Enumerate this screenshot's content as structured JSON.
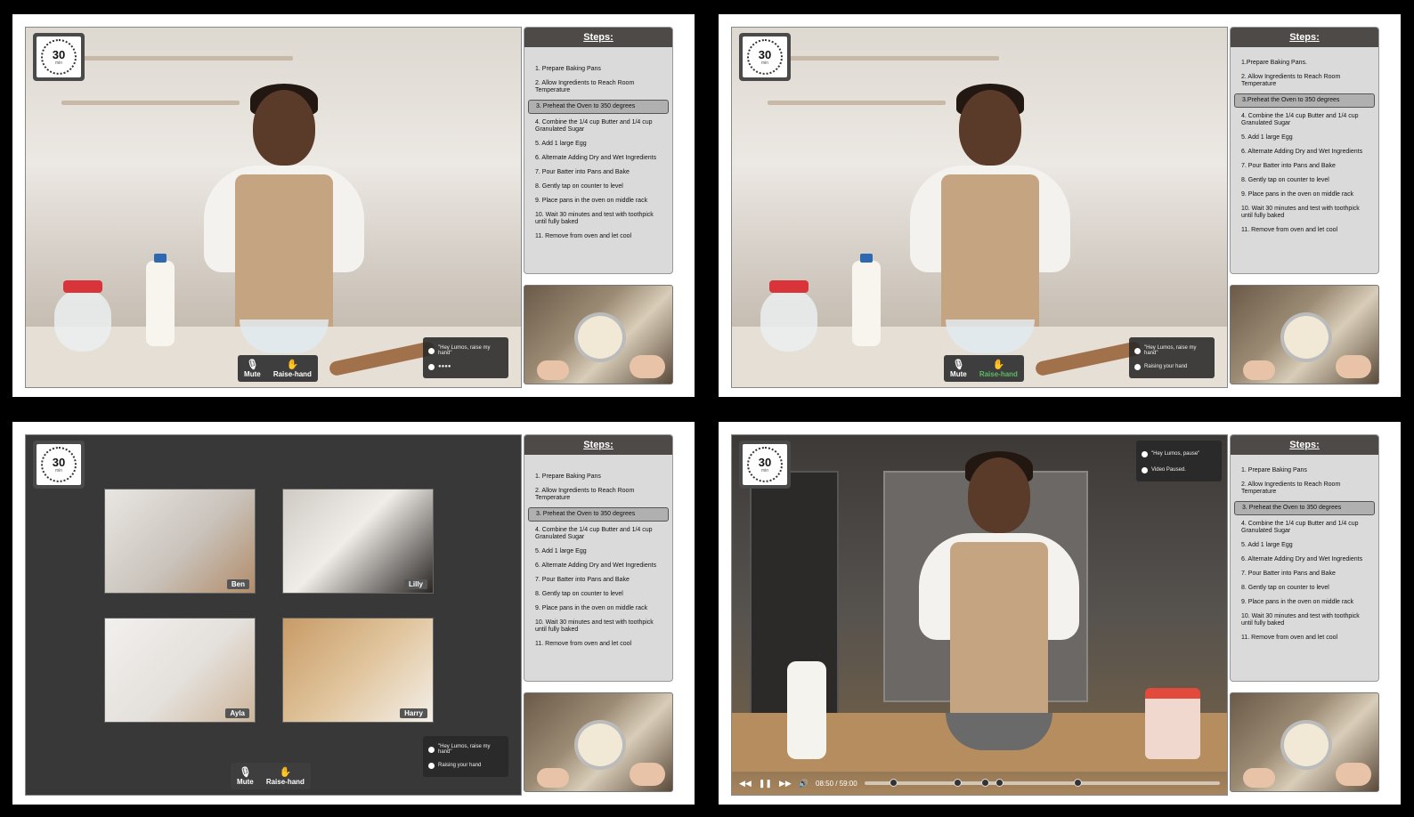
{
  "timer": {
    "value": "30",
    "unit": "min"
  },
  "steps_title": "Steps:",
  "steps_a": [
    "1. Prepare Baking Pans",
    "2. Allow Ingredients to Reach Room Temperature",
    "3. Preheat the Oven to 350 degrees",
    "4. Combine the 1/4 cup Butter and 1/4 cup Granulated Sugar",
    "5. Add 1 large Egg",
    "6. Alternate Adding Dry and Wet Ingredients",
    "7. Pour Batter into Pans and Bake",
    "8. Gently tap on counter to level",
    "9. Place pans in the oven on middle rack",
    "10. Wait 30 minutes and test with toothpick until fully baked",
    "11. Remove from oven and let cool"
  ],
  "steps_b": [
    "1.Prepare Baking Pans.",
    "2. Allow Ingredients to Reach Room Temperature",
    "3.Preheat the Oven to 350 degrees",
    "4. Combine the 1/4 cup Butter and 1/4 cup Granulated Sugar",
    "5. Add 1 large Egg",
    "6. Alternate Adding Dry and Wet Ingredients",
    "7. Pour Batter into Pans and Bake",
    "8. Gently tap on counter to level",
    "9. Place pans in the oven on middle rack",
    "10. Wait 30 minutes and test with toothpick until fully baked",
    "11. Remove from oven and let cool"
  ],
  "highlight_index": 2,
  "controls": {
    "mute": "Mute",
    "raise_hand": "Raise-hand",
    "raise_hand_active_color": "#5dbb63"
  },
  "voice": {
    "raise_cmd": "\"Hey Lumos, raise my hand\"",
    "listening": "●●●●",
    "raising": "Raising your hand",
    "pause_cmd": "\"Hey Lumos, pause\"",
    "paused": "Video Paused."
  },
  "participants": [
    "Ben",
    "Lilly",
    "Ayla",
    "Harry"
  ],
  "player": {
    "time": "08:50 / 59:00",
    "progress": 0.15,
    "chapter_marks": [
      0.08,
      0.26,
      0.34,
      0.38,
      0.6
    ]
  }
}
